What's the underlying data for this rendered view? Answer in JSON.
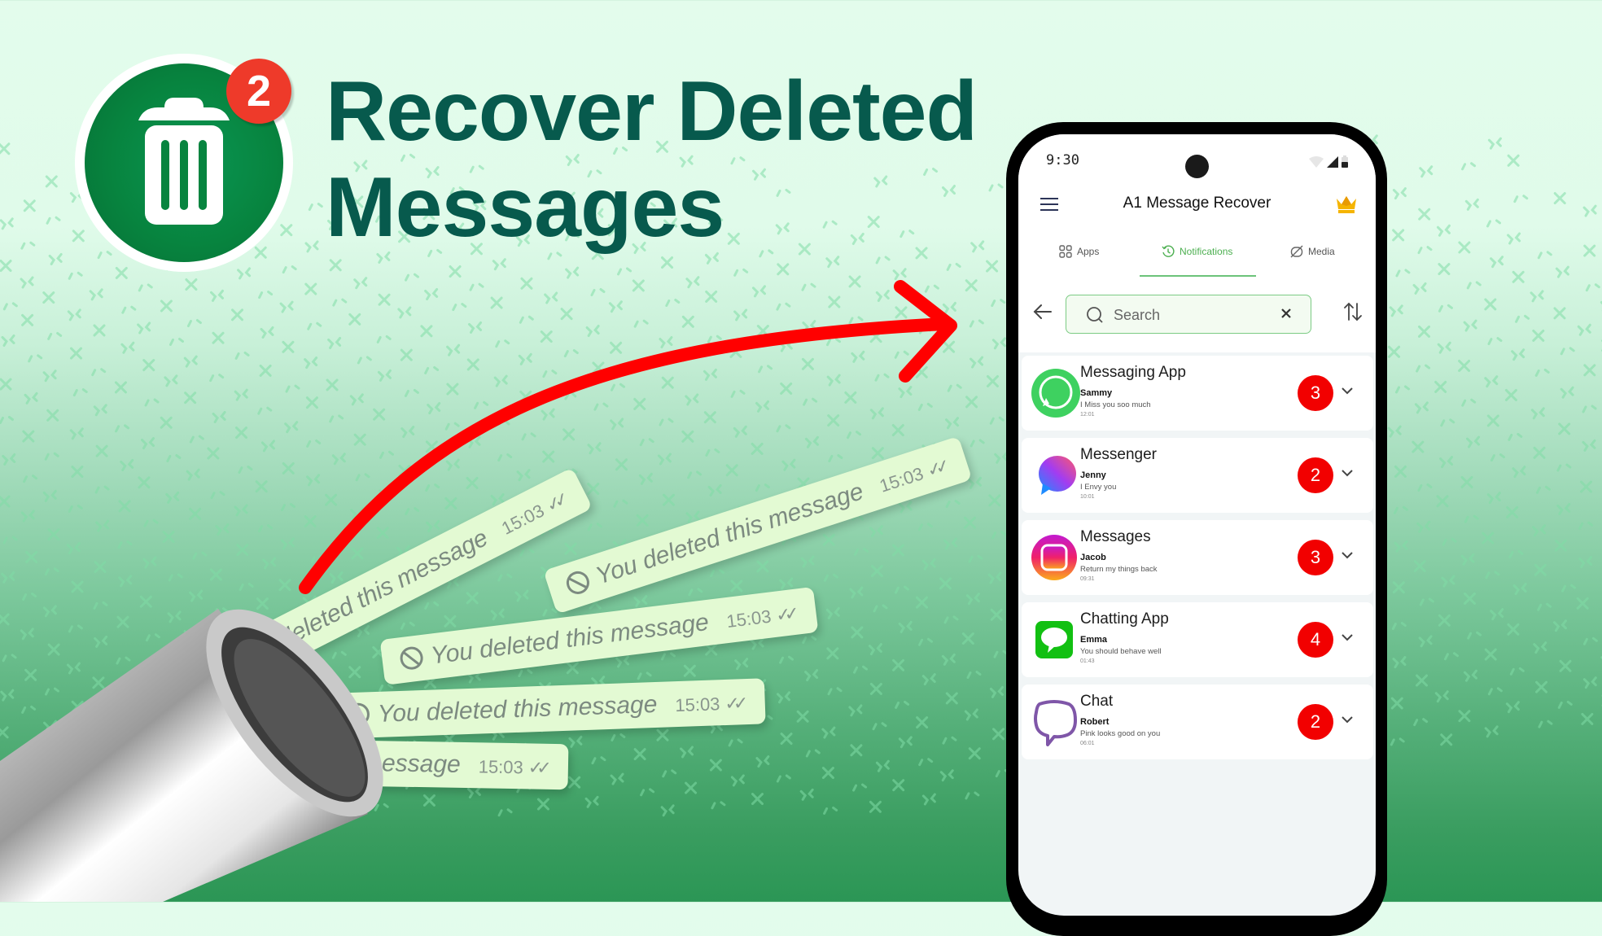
{
  "colors": {
    "brand_dark_green": "#075a4d",
    "logo_green": "#07843f",
    "badge_red": "#f20000",
    "arrow_red": "#ff0000",
    "accent_green": "#4caf50",
    "bubble_bg": "#e3fad3"
  },
  "hero": {
    "logo_icon": "trash-can-icon",
    "logo_badge_count": "2",
    "headline_line1": "Recover Deleted",
    "headline_line2": "Messages"
  },
  "deleted_bubbles": [
    {
      "text": "You deleted this message",
      "time": "15:03",
      "ticks": "✓✓"
    },
    {
      "text": "You deleted this message",
      "time": "15:03",
      "ticks": "✓✓"
    },
    {
      "text": "You deleted this message",
      "time": "15:03",
      "ticks": "✓✓"
    },
    {
      "text": "You deleted this message",
      "time": "15:03",
      "ticks": "✓✓"
    },
    {
      "text": "d this message",
      "time": "15:03",
      "ticks": "✓✓"
    }
  ],
  "phone": {
    "status_bar": {
      "time": "9:30",
      "icons": [
        "wifi-icon",
        "signal-icon",
        "battery-icon"
      ]
    },
    "app_bar": {
      "title": "A1 Message Recover",
      "menu_icon": "hamburger-menu-icon",
      "premium_icon": "crown-icon"
    },
    "tabs": [
      {
        "label": "Apps",
        "icon": "grid-icon",
        "active": false
      },
      {
        "label": "Notifications",
        "icon": "history-clock-icon",
        "active": true
      },
      {
        "label": "Media",
        "icon": "image-off-icon",
        "active": false
      }
    ],
    "search": {
      "placeholder": "Search",
      "value": ""
    },
    "conversations": [
      {
        "app": "Messaging App",
        "sender": "Sammy",
        "message": "I Miss you soo much",
        "time": "12:01",
        "count": "3",
        "icon": "whatsapp-style-icon"
      },
      {
        "app": "Messenger",
        "sender": "Jenny",
        "message": "I Envy you",
        "time": "10:01",
        "count": "2",
        "icon": "messenger-style-icon"
      },
      {
        "app": "Messages",
        "sender": "Jacob",
        "message": "Return my things back",
        "time": "09:31",
        "count": "3",
        "icon": "instagram-style-icon"
      },
      {
        "app": "Chatting App",
        "sender": "Emma",
        "message": "You should behave well",
        "time": "01:43",
        "count": "4",
        "icon": "imessage-style-icon"
      },
      {
        "app": "Chat",
        "sender": "Robert",
        "message": "Pink looks good on you",
        "time": "06:01",
        "count": "2",
        "icon": "viber-style-icon"
      }
    ]
  }
}
